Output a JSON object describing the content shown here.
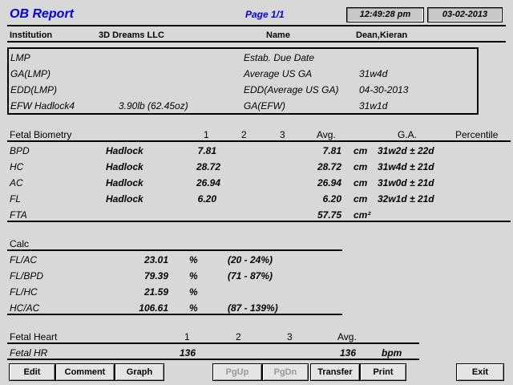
{
  "header": {
    "title": "OB Report",
    "page": "Page 1/1",
    "time": "12:49:28 pm",
    "date": "03-02-2013"
  },
  "patient": {
    "institution_label": "Institution",
    "institution_value": "3D Dreams LLC",
    "name_label": "Name",
    "name_value": "Dean,Kieran"
  },
  "summary": {
    "lmp_label": "LMP",
    "ga_lmp_label": "GA(LMP)",
    "edd_lmp_label": "EDD(LMP)",
    "efw_label": "EFW Hadlock4",
    "efw_value": "3.90lb (62.45oz)",
    "estab_due_label": "Estab. Due Date",
    "avg_us_ga_label": "Average US GA",
    "avg_us_ga_value": "31w4d",
    "edd_avg_label": "EDD(Average US GA)",
    "edd_avg_value": "04-30-2013",
    "ga_efw_label": "GA(EFW)",
    "ga_efw_value": "31w1d"
  },
  "biometry": {
    "section_label": "Fetal Biometry",
    "col1": "1",
    "col2": "2",
    "col3": "3",
    "col_avg": "Avg.",
    "col_ga": "G.A.",
    "col_pct": "Percentile",
    "rows": [
      {
        "name": "BPD",
        "method": "Hadlock",
        "v1": "7.81",
        "avg": "7.81",
        "unit": "cm",
        "ga": "31w2d ± 22d"
      },
      {
        "name": "HC",
        "method": "Hadlock",
        "v1": "28.72",
        "avg": "28.72",
        "unit": "cm",
        "ga": "31w4d ± 21d"
      },
      {
        "name": "AC",
        "method": "Hadlock",
        "v1": "26.94",
        "avg": "26.94",
        "unit": "cm",
        "ga": "31w0d ± 21d"
      },
      {
        "name": "FL",
        "method": "Hadlock",
        "v1": "6.20",
        "avg": "6.20",
        "unit": "cm",
        "ga": "32w1d ± 21d"
      },
      {
        "name": "FTA",
        "method": "",
        "v1": "",
        "avg": "57.75",
        "unit": "cm²",
        "ga": ""
      }
    ]
  },
  "calc": {
    "section_label": "Calc",
    "rows": [
      {
        "name": "FL/AC",
        "value": "23.01",
        "unit": "%",
        "range": "(20 - 24%)"
      },
      {
        "name": "FL/BPD",
        "value": "79.39",
        "unit": "%",
        "range": "(71 - 87%)"
      },
      {
        "name": "FL/HC",
        "value": "21.59",
        "unit": "%",
        "range": ""
      },
      {
        "name": "HC/AC",
        "value": "106.61",
        "unit": "%",
        "range": "(87 - 139%)"
      }
    ]
  },
  "heart": {
    "section_label": "Fetal Heart",
    "col1": "1",
    "col2": "2",
    "col3": "3",
    "col_avg": "Avg.",
    "row_name": "Fetal HR",
    "row_v1": "136",
    "row_avg": "136",
    "row_unit": "bpm"
  },
  "toolbar": {
    "edit": "Edit",
    "comment": "Comment",
    "graph": "Graph",
    "pgup": "PgUp",
    "pgdn": "PgDn",
    "transfer": "Transfer",
    "print": "Print",
    "exit": "Exit"
  }
}
